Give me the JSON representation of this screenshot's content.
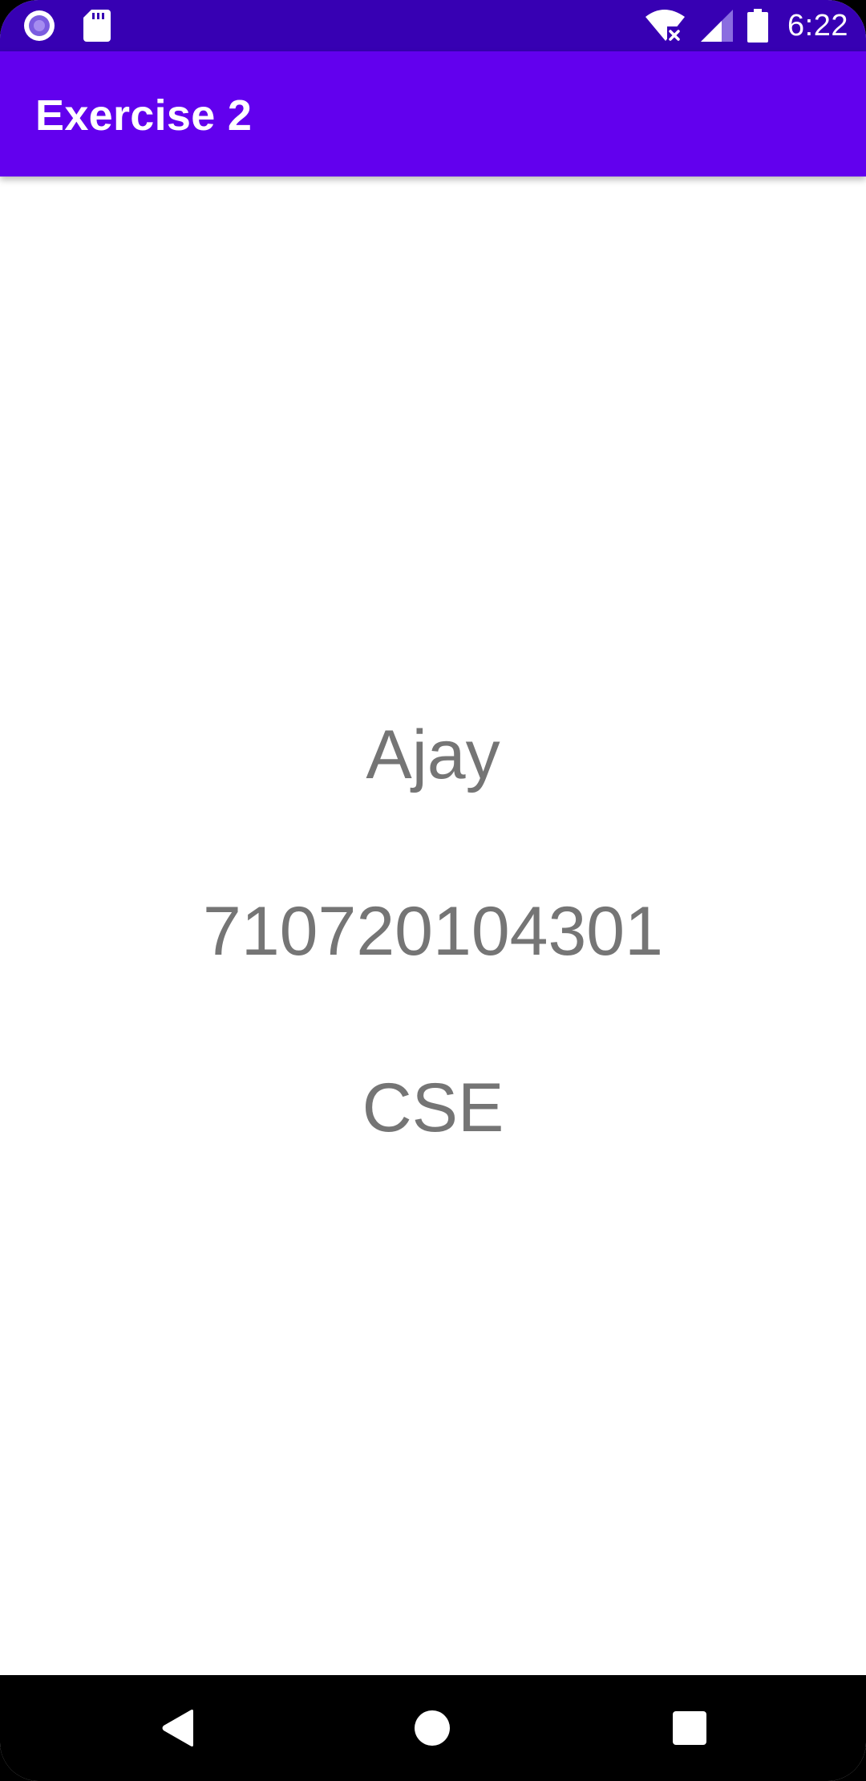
{
  "status_bar": {
    "time": "6:22",
    "left_icons": [
      "record-icon",
      "sd-card-icon"
    ],
    "right_icons": [
      "wifi-no-internet-icon",
      "cell-signal-icon",
      "battery-icon"
    ],
    "background": "#3700B3"
  },
  "app_bar": {
    "title": "Exercise 2",
    "background": "#6200EE"
  },
  "main": {
    "name": "Ajay",
    "register_number": "710720104301",
    "department": "CSE",
    "text_color": "#757575"
  },
  "nav_bar": {
    "buttons": [
      "back-icon",
      "home-icon",
      "recents-icon"
    ]
  }
}
